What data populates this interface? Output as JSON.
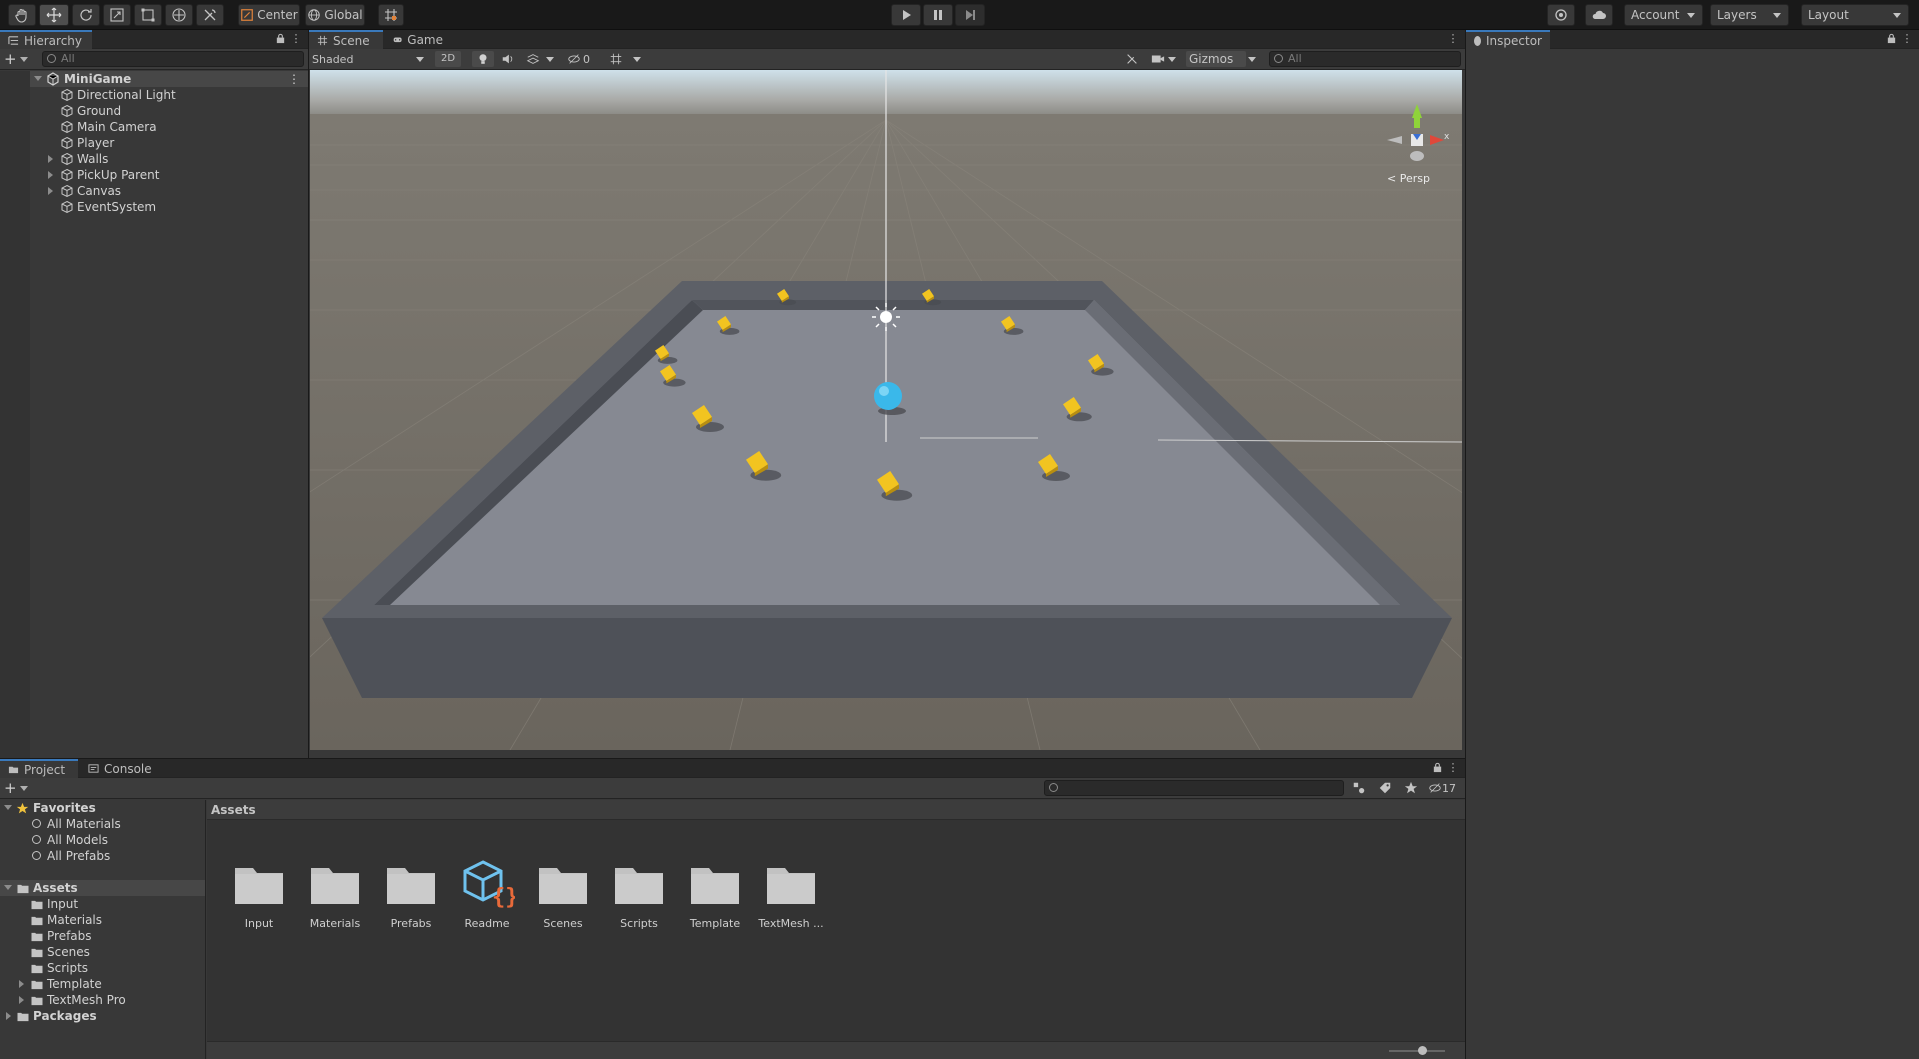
{
  "toolbar": {
    "pivot_label": "Center",
    "space_label": "Global",
    "account_label": "Account",
    "layers_label": "Layers",
    "layout_label": "Layout"
  },
  "hierarchy": {
    "tab_label": "Hierarchy",
    "search_placeholder": "All",
    "scene_name": "MiniGame",
    "items": [
      {
        "label": "Directional Light",
        "expandable": false
      },
      {
        "label": "Ground",
        "expandable": false
      },
      {
        "label": "Main Camera",
        "expandable": false
      },
      {
        "label": "Player",
        "expandable": false
      },
      {
        "label": "Walls",
        "expandable": true
      },
      {
        "label": "PickUp Parent",
        "expandable": true
      },
      {
        "label": "Canvas",
        "expandable": true
      },
      {
        "label": "EventSystem",
        "expandable": false
      }
    ]
  },
  "scene": {
    "tabs": [
      {
        "label": "Scene",
        "active": true
      },
      {
        "label": "Game",
        "active": false
      }
    ],
    "shading_mode": "Shaded",
    "mode_2d": "2D",
    "hidden_count": "0",
    "gizmos_label": "Gizmos",
    "search_placeholder": "All",
    "persp_label": "< Persp",
    "axis_x_label": "x",
    "colors": {
      "pickup": "#f2c420",
      "player": "#3ab8ea",
      "ground": "#84878f",
      "wall": "#5a5d64"
    }
  },
  "inspector": {
    "tab_label": "Inspector"
  },
  "project": {
    "tabs": [
      {
        "label": "Project",
        "active": true
      },
      {
        "label": "Console",
        "active": false
      }
    ],
    "hidden_count": "17",
    "favorites_label": "Favorites",
    "favorites": [
      "All Materials",
      "All Models",
      "All Prefabs"
    ],
    "assets_label": "Assets",
    "asset_folders": [
      {
        "label": "Input",
        "expandable": false
      },
      {
        "label": "Materials",
        "expandable": false
      },
      {
        "label": "Prefabs",
        "expandable": false
      },
      {
        "label": "Scenes",
        "expandable": false
      },
      {
        "label": "Scripts",
        "expandable": false
      },
      {
        "label": "Template",
        "expandable": true
      },
      {
        "label": "TextMesh Pro",
        "expandable": true
      }
    ],
    "packages_label": "Packages",
    "breadcrumb": "Assets",
    "grid_items": [
      {
        "label": "Input",
        "icon": "folder-icon"
      },
      {
        "label": "Materials",
        "icon": "folder-icon"
      },
      {
        "label": "Prefabs",
        "icon": "folder-icon"
      },
      {
        "label": "Readme",
        "icon": "readme-script-icon"
      },
      {
        "label": "Scenes",
        "icon": "folder-icon"
      },
      {
        "label": "Scripts",
        "icon": "folder-icon"
      },
      {
        "label": "Template",
        "icon": "folder-icon"
      },
      {
        "label": "TextMesh ...",
        "icon": "folder-icon"
      }
    ]
  }
}
